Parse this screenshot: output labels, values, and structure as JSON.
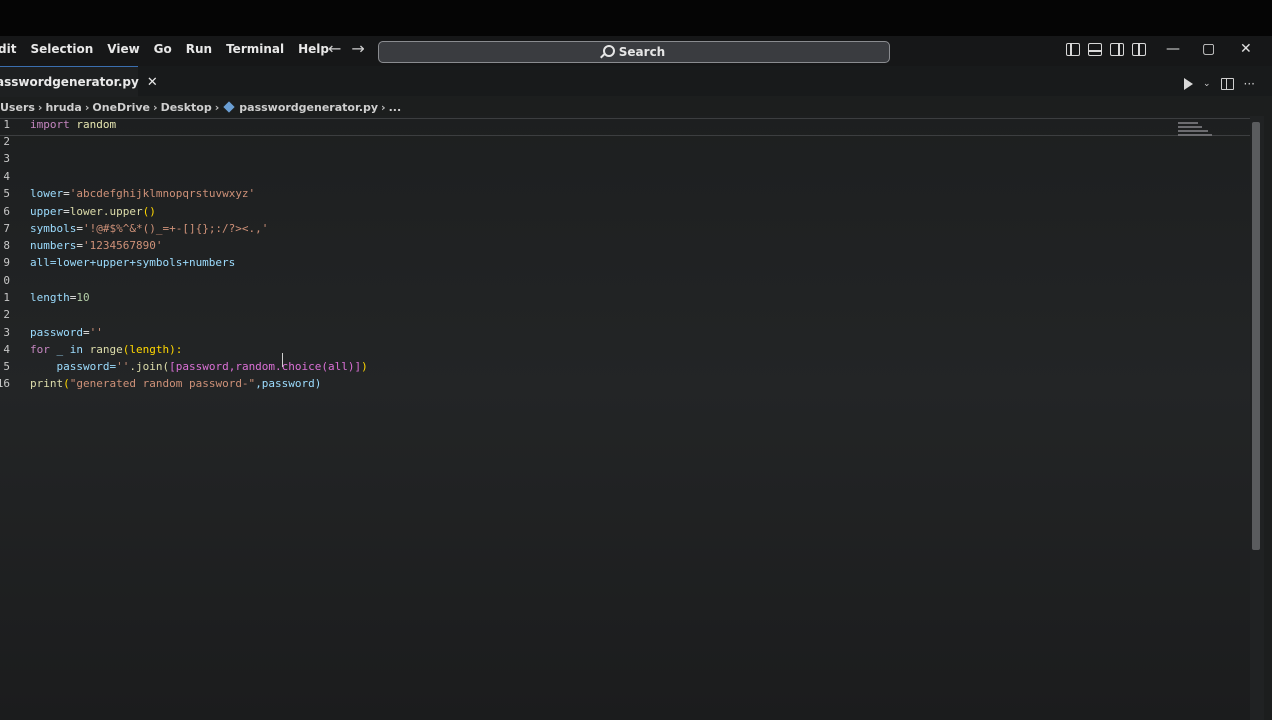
{
  "menu": [
    "dit",
    "Selection",
    "View",
    "Go",
    "Run",
    "Terminal",
    "Help"
  ],
  "search": {
    "label": "Search"
  },
  "tab": {
    "label": "asswordgenerator.py",
    "close": "✕"
  },
  "breadcrumb": [
    "Users",
    "hruda",
    "OneDrive",
    "Desktop",
    "passwordgenerator.py",
    "..."
  ],
  "line_numbers": [
    "1",
    "2",
    "3",
    "4",
    "5",
    "6",
    "7",
    "8",
    "9",
    "0",
    "1",
    "2",
    "3",
    "4",
    "5",
    "16"
  ],
  "code_text": {
    "l1_kw": "import",
    "l1_mod": " random",
    "l5_var": "lower",
    "l5_str": "'abcdefghijklmnopqrstuvwxyz'",
    "l6_var": "upper",
    "l6_rest": "lower.upper",
    "l6_paren": "()",
    "l7_var": "symbols",
    "l7_str": "'!@#$%^&*()_=+-[]{};:/?><.,'",
    "l8_var": "numbers",
    "l8_str": "'1234567890'",
    "l9": "all=lower+upper+symbols+numbers",
    "l11_var": "length",
    "l11_num": "10",
    "l13_var": "password",
    "l13_str": "''",
    "l14_for": "for",
    "l14_mid": " _ in ",
    "l14_fn": "range",
    "l14_rest": "(length):",
    "l15_indent": "    password=",
    "l15_str": "''",
    "l15_join": ".join(",
    "l15_list": "[password,random.choice(all)]",
    "l15_end": ")",
    "l16_fn": "print",
    "l16_str": "\"generated random password-\"",
    "l16_rest": ",password)"
  },
  "colors": {
    "keyword": "#c586c0",
    "string": "#ce9178",
    "number": "#b5cea8",
    "function": "#dcdcaa",
    "accent": "#3b6fb0"
  },
  "icons": [
    "back-arrow-icon",
    "forward-arrow-icon",
    "search-icon",
    "layout-sidebar-left-icon",
    "layout-panel-icon",
    "layout-sidebar-right-icon",
    "customize-layout-icon",
    "minimize-icon",
    "restore-icon",
    "close-icon",
    "run-icon",
    "split-editor-icon",
    "more-actions-icon",
    "python-file-icon"
  ]
}
